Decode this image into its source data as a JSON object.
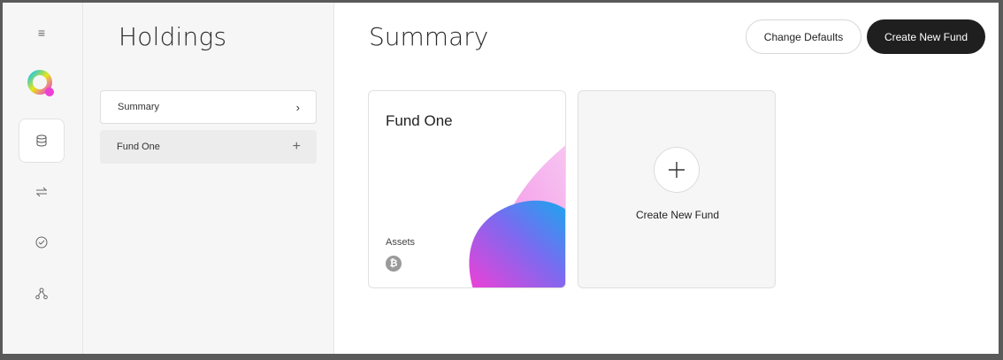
{
  "rail": {
    "icons": [
      "menu-icon",
      "app-logo",
      "database-icon",
      "transfer-icon",
      "check-circle-icon",
      "network-icon"
    ],
    "menu_glyph": "≡"
  },
  "holdings": {
    "title": "Holdings",
    "items": [
      {
        "label": "Summary",
        "icon": "chevron-right-icon",
        "glyph": "›"
      },
      {
        "label": "Fund One",
        "icon": "plus-icon",
        "glyph": "+"
      }
    ]
  },
  "main": {
    "title": "Summary",
    "buttons": {
      "change_defaults": "Change Defaults",
      "create_new_fund": "Create New Fund"
    },
    "fund_card": {
      "name": "Fund One",
      "assets_label": "Assets",
      "asset_glyph": "₿",
      "asset_icon": "bitcoin-icon"
    },
    "new_card": {
      "label": "Create New Fund",
      "icon": "plus-icon"
    }
  },
  "colors": {
    "accent_dark": "#1f1f1f",
    "logo_gradient": [
      "#19c6e6",
      "#e6e619",
      "#ec3fd4"
    ]
  }
}
